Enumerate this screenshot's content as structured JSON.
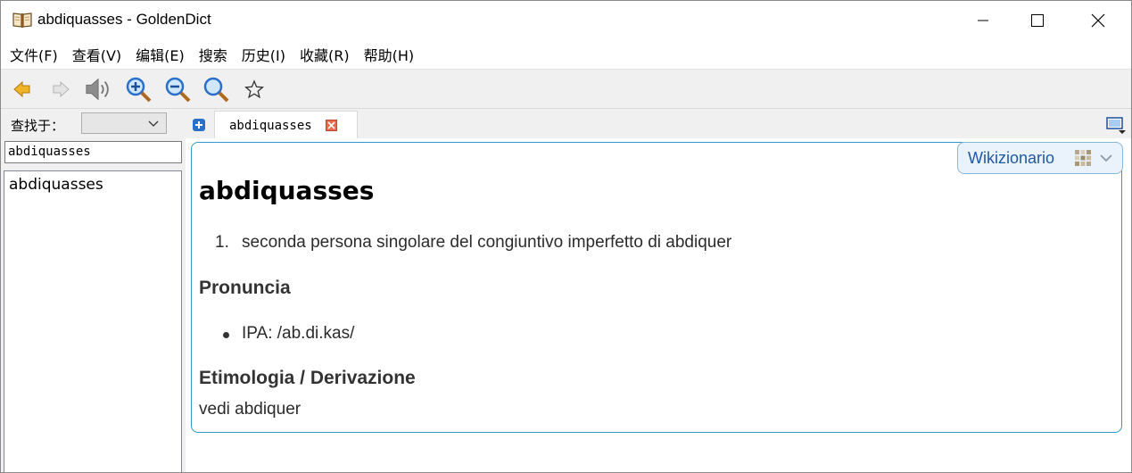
{
  "window": {
    "title": "abdiquasses - GoldenDict",
    "app_icon": "open-book-icon",
    "controls": [
      "minimize-icon",
      "maximize-icon",
      "close-icon"
    ]
  },
  "menu": {
    "items": [
      "文件(F)",
      "查看(V)",
      "编辑(E)",
      "搜索",
      "历史(I)",
      "收藏(R)",
      "帮助(H)"
    ]
  },
  "toolbar": {
    "buttons": [
      "back-arrow-icon",
      "forward-arrow-icon",
      "speaker-icon",
      "zoom-in-icon",
      "zoom-out-icon",
      "zoom-reset-icon",
      "favorite-star-icon"
    ]
  },
  "search_panel": {
    "lookup_label": "查找于：",
    "lookup_value": "",
    "query": "abdiquasses",
    "results": [
      "abdiquasses"
    ]
  },
  "tabs": [
    {
      "label": "abdiquasses",
      "active": true
    }
  ],
  "article": {
    "dictionary_name": "Wikizionario",
    "headword": "abdiquasses",
    "definitions": [
      {
        "num": "1.",
        "text": "seconda persona singolare del congiuntivo imperfetto di abdiquer"
      }
    ],
    "pronunciation_heading": "Pronuncia",
    "ipa": "IPA: /ab.di.kas/",
    "etymology_heading": "Etimologia / Derivazione",
    "etymology_text": "vedi abdiquer"
  },
  "colors": {
    "article_border": "#3399cc",
    "dict_tag_bg": "#eaf3fb",
    "dict_tag_text": "#2158a6",
    "back_arrow": "#f0b428"
  }
}
